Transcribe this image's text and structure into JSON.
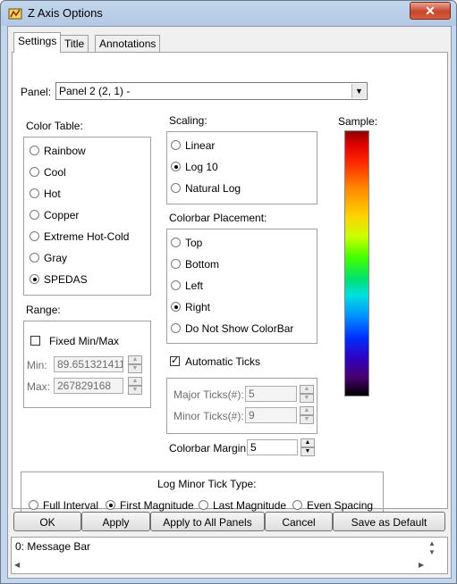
{
  "window": {
    "title": "Z Axis Options",
    "close_label": "✕"
  },
  "tabs": [
    "Settings",
    "Title",
    "Annotations"
  ],
  "panel": {
    "label": "Panel:",
    "value": "Panel 2 (2, 1)  -"
  },
  "color_table": {
    "label": "Color Table:",
    "options": [
      "Rainbow",
      "Cool",
      "Hot",
      "Copper",
      "Extreme Hot-Cold",
      "Gray",
      "SPEDAS"
    ],
    "selected": "SPEDAS"
  },
  "range": {
    "label": "Range:",
    "fixed_label": "Fixed Min/Max",
    "fixed_checked": false,
    "min_label": "Min:",
    "min_value": "89.6513214111",
    "max_label": "Max:",
    "max_value": "267829168"
  },
  "scaling": {
    "label": "Scaling:",
    "options": [
      "Linear",
      "Log 10",
      "Natural Log"
    ],
    "selected": "Log 10"
  },
  "placement": {
    "label": "Colorbar Placement:",
    "options": [
      "Top",
      "Bottom",
      "Left",
      "Right",
      "Do Not Show ColorBar"
    ],
    "selected": "Right"
  },
  "ticks": {
    "auto_label": "Automatic Ticks",
    "auto_checked": true,
    "major_label": "Major Ticks(#):",
    "major_value": "5",
    "minor_label": "Minor Ticks(#):",
    "minor_value": "9"
  },
  "margin": {
    "label": "Colorbar Margin:",
    "value": "5"
  },
  "sample": {
    "label": "Sample:"
  },
  "log_minor": {
    "label": "Log Minor Tick Type:",
    "options": [
      "Full Interval",
      "First Magnitude",
      "Last Magnitude",
      "Even Spacing"
    ],
    "selected": "First Magnitude"
  },
  "buttons": [
    "OK",
    "Apply",
    "Apply to All Panels",
    "Cancel",
    "Save as Default"
  ],
  "message_bar": {
    "text": "0: Message Bar"
  }
}
